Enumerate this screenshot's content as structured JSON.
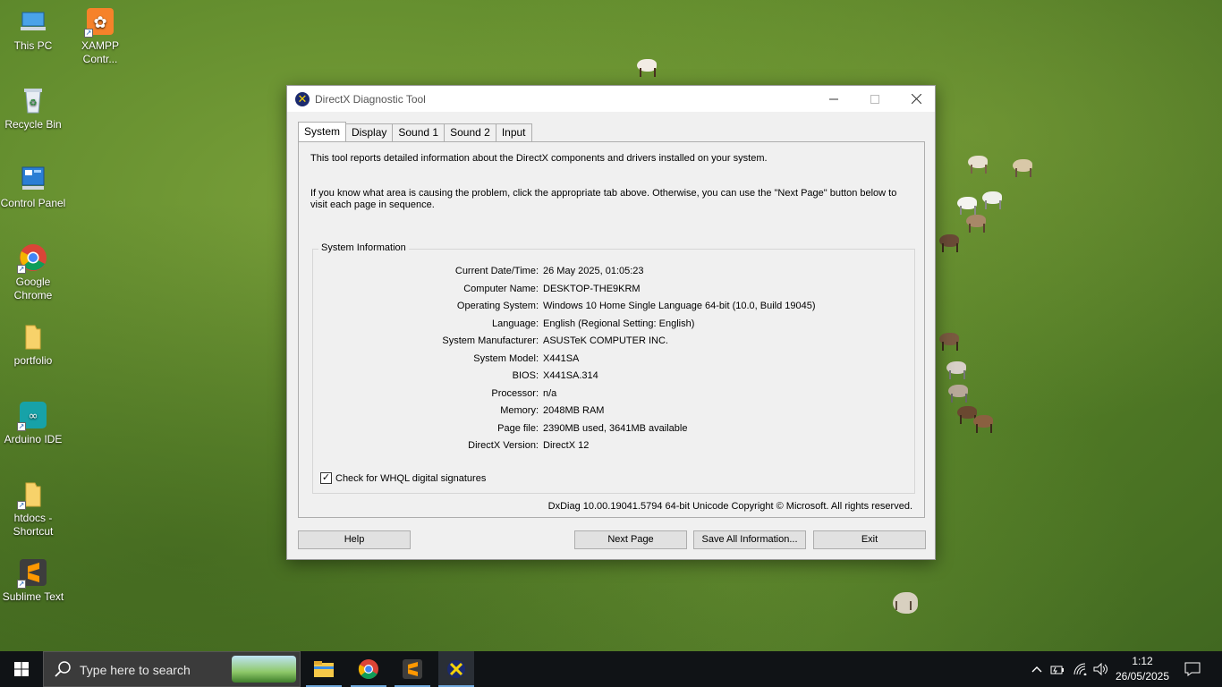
{
  "desktop": {
    "icons": [
      {
        "label": "This PC"
      },
      {
        "label": "XAMPP Contr..."
      },
      {
        "label": "Recycle Bin"
      },
      {
        "label": "Control Panel"
      },
      {
        "label": "Google Chrome"
      },
      {
        "label": "portfolio"
      },
      {
        "label": "Arduino IDE"
      },
      {
        "label": "htdocs - Shortcut"
      },
      {
        "label": "Sublime Text"
      }
    ]
  },
  "window": {
    "title": "DirectX Diagnostic Tool",
    "tabs": [
      "System",
      "Display",
      "Sound 1",
      "Sound 2",
      "Input"
    ],
    "active_tab": "System",
    "intro_1": "This tool reports detailed information about the DirectX components and drivers installed on your system.",
    "intro_2": "If you know what area is causing the problem, click the appropriate tab above.  Otherwise, you can use the \"Next Page\" button below to visit each page in sequence.",
    "group_title": "System Information",
    "info": [
      {
        "key": "Current Date/Time:",
        "value": "26 May 2025, 01:05:23"
      },
      {
        "key": "Computer Name:",
        "value": "DESKTOP-THE9KRM"
      },
      {
        "key": "Operating System:",
        "value": "Windows 10 Home Single Language 64-bit (10.0, Build 19045)"
      },
      {
        "key": "Language:",
        "value": "English (Regional Setting: English)"
      },
      {
        "key": "System Manufacturer:",
        "value": "ASUSTeK COMPUTER INC."
      },
      {
        "key": "System Model:",
        "value": "X441SA"
      },
      {
        "key": "BIOS:",
        "value": "X441SA.314"
      },
      {
        "key": "Processor:",
        "value": "n/a"
      },
      {
        "key": "Memory:",
        "value": "2048MB RAM"
      },
      {
        "key": "Page file:",
        "value": "2390MB used, 3641MB available"
      },
      {
        "key": "DirectX Version:",
        "value": "DirectX 12"
      }
    ],
    "whql_label": "Check for WHQL digital signatures",
    "whql_checked": true,
    "footer": "DxDiag 10.00.19041.5794 64-bit Unicode  Copyright © Microsoft. All rights reserved.",
    "buttons": {
      "help": "Help",
      "next_page": "Next Page",
      "save_all": "Save All Information...",
      "exit": "Exit"
    }
  },
  "taskbar": {
    "search_placeholder": "Type here to search",
    "apps": [
      "file-explorer",
      "google-chrome",
      "sublime-text",
      "directx-diagnostic"
    ],
    "clock_time": "1:12",
    "clock_date": "26/05/2025"
  },
  "colors": {
    "accent": "#6fa8dc",
    "taskbar_bg": "#101316",
    "window_bg": "#f0f0f0"
  }
}
